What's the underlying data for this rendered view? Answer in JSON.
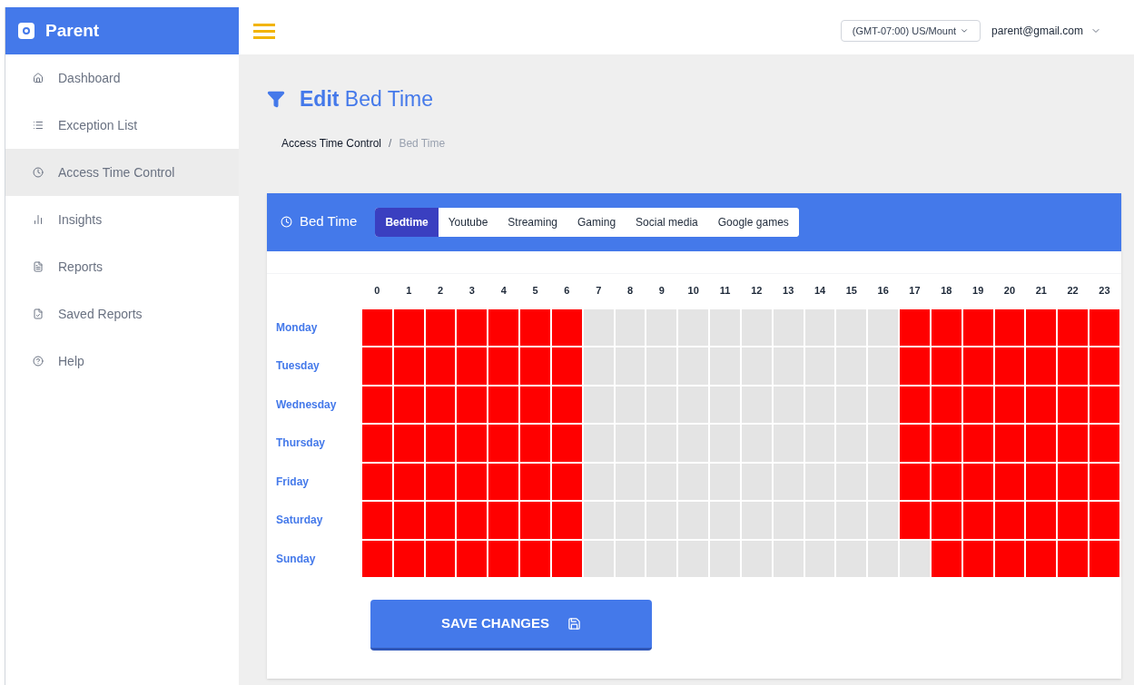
{
  "brand": {
    "name": "Parent"
  },
  "sidebar": {
    "items": [
      {
        "label": "Dashboard",
        "selected": false
      },
      {
        "label": "Exception List",
        "selected": false
      },
      {
        "label": "Access Time Control",
        "selected": true
      },
      {
        "label": "Insights",
        "selected": false
      },
      {
        "label": "Reports",
        "selected": false
      },
      {
        "label": "Saved Reports",
        "selected": false
      },
      {
        "label": "Help",
        "selected": false
      }
    ]
  },
  "topbar": {
    "timezone": "(GMT-07:00) US/Mount",
    "user": "parent@gmail.com"
  },
  "page": {
    "title_bold": "Edit",
    "title_rest": "Bed Time",
    "breadcrumb": [
      "Access Time Control",
      "Bed Time"
    ],
    "breadcrumb_separator": "/"
  },
  "card": {
    "title": "Bed Time",
    "tabs": [
      {
        "label": "Bedtime",
        "selected": true
      },
      {
        "label": "Youtube",
        "selected": false
      },
      {
        "label": "Streaming",
        "selected": false
      },
      {
        "label": "Gaming",
        "selected": false
      },
      {
        "label": "Social media",
        "selected": false
      },
      {
        "label": "Google games",
        "selected": false
      }
    ]
  },
  "schedule": {
    "hours": [
      "0",
      "1",
      "2",
      "3",
      "4",
      "5",
      "6",
      "7",
      "8",
      "9",
      "10",
      "11",
      "12",
      "13",
      "14",
      "15",
      "16",
      "17",
      "18",
      "19",
      "20",
      "21",
      "22",
      "23"
    ],
    "days": [
      {
        "label": "Monday",
        "blocked": [
          true,
          true,
          true,
          true,
          true,
          true,
          true,
          false,
          false,
          false,
          false,
          false,
          false,
          false,
          false,
          false,
          false,
          true,
          true,
          true,
          true,
          true,
          true,
          true
        ]
      },
      {
        "label": "Tuesday",
        "blocked": [
          true,
          true,
          true,
          true,
          true,
          true,
          true,
          false,
          false,
          false,
          false,
          false,
          false,
          false,
          false,
          false,
          false,
          true,
          true,
          true,
          true,
          true,
          true,
          true
        ]
      },
      {
        "label": "Wednesday",
        "blocked": [
          true,
          true,
          true,
          true,
          true,
          true,
          true,
          false,
          false,
          false,
          false,
          false,
          false,
          false,
          false,
          false,
          false,
          true,
          true,
          true,
          true,
          true,
          true,
          true
        ]
      },
      {
        "label": "Thursday",
        "blocked": [
          true,
          true,
          true,
          true,
          true,
          true,
          true,
          false,
          false,
          false,
          false,
          false,
          false,
          false,
          false,
          false,
          false,
          true,
          true,
          true,
          true,
          true,
          true,
          true
        ]
      },
      {
        "label": "Friday",
        "blocked": [
          true,
          true,
          true,
          true,
          true,
          true,
          true,
          false,
          false,
          false,
          false,
          false,
          false,
          false,
          false,
          false,
          false,
          true,
          true,
          true,
          true,
          true,
          true,
          true
        ]
      },
      {
        "label": "Saturday",
        "blocked": [
          true,
          true,
          true,
          true,
          true,
          true,
          true,
          false,
          false,
          false,
          false,
          false,
          false,
          false,
          false,
          false,
          false,
          true,
          true,
          true,
          true,
          true,
          true,
          true
        ]
      },
      {
        "label": "Sunday",
        "blocked": [
          true,
          true,
          true,
          true,
          true,
          true,
          true,
          false,
          false,
          false,
          false,
          false,
          false,
          false,
          false,
          false,
          false,
          false,
          true,
          true,
          true,
          true,
          true,
          true
        ]
      }
    ]
  },
  "save_button": "SAVE CHANGES"
}
